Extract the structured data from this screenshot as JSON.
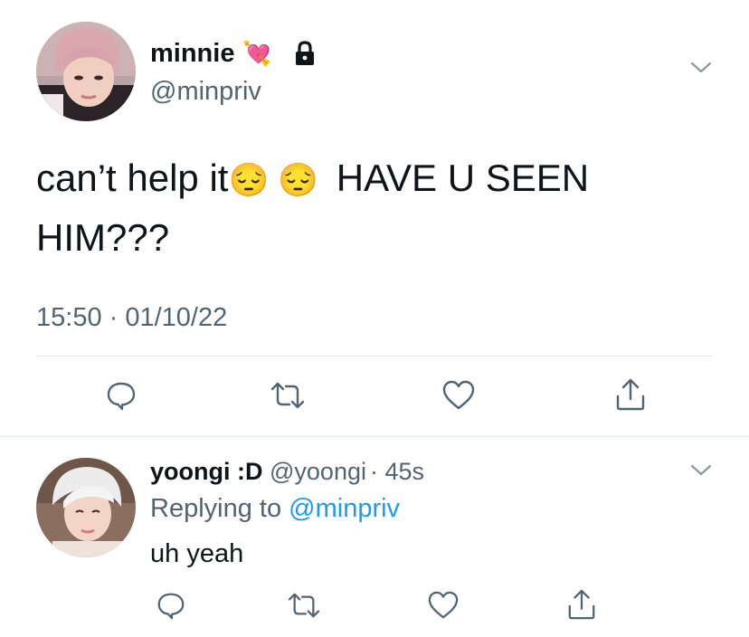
{
  "main_tweet": {
    "display_name": "minnie",
    "name_emoji": "💘",
    "handle": "@minpriv",
    "text_line1": "can’t help it",
    "text_emoji": "😔 😔",
    "text_line1_after": "HAVE U SEEN",
    "text_line2": "HIM???",
    "timestamp": "15:50 · 01/10/22"
  },
  "reply_tweet": {
    "display_name": "yoongi :D",
    "handle": "@yoongi",
    "age": "· 45s",
    "replying_prefix": "Replying to",
    "replying_handle": "@minpriv",
    "text": "uh yeah"
  },
  "icons": {
    "reply": "reply-icon",
    "retweet": "retweet-icon",
    "like": "heart-icon",
    "share": "share-icon",
    "more": "chevron-down-icon",
    "lock": "lock-icon"
  },
  "colors": {
    "text": "#0f1419",
    "secondary": "#536471",
    "link": "#1d9bf0",
    "divider": "#e1e8ed"
  }
}
